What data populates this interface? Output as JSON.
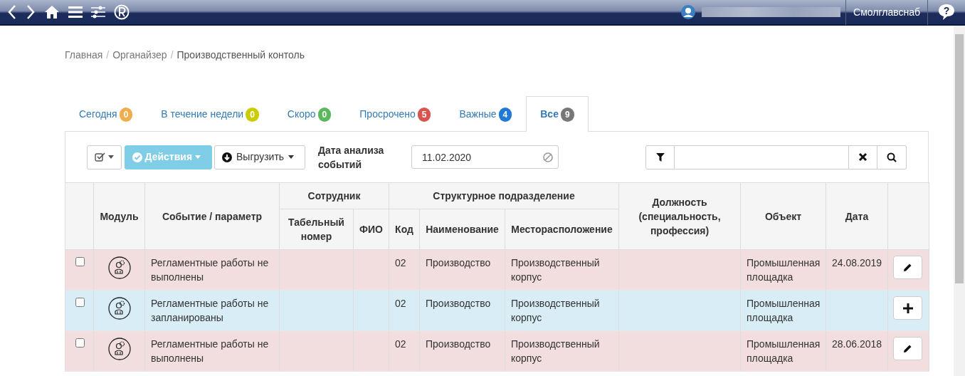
{
  "topbar": {
    "org": "Смолглавснаб",
    "help": "?"
  },
  "breadcrumb": [
    {
      "label": "Главная",
      "current": false
    },
    {
      "separator": "/",
      "label": "Органайзер",
      "current": false
    },
    {
      "separator": "/",
      "label": "Производственный контоль",
      "current": true
    }
  ],
  "tabs": [
    {
      "label": "Сегодня",
      "count": "0",
      "color": "#f0ad4e",
      "selected": false
    },
    {
      "label": "В течение недели",
      "count": "0",
      "color": "#cccc00",
      "selected": false
    },
    {
      "label": "Скоро",
      "count": "0",
      "color": "#5cb85c",
      "selected": false
    },
    {
      "label": "Просрочено",
      "count": "5",
      "color": "#d9534f",
      "selected": false
    },
    {
      "label": "Важные",
      "count": "4",
      "color": "#1e7ad6",
      "selected": false
    },
    {
      "label": "Все",
      "count": "9",
      "color": "#777777",
      "selected": true
    }
  ],
  "toolbar": {
    "actions": "Действия",
    "export": "Выгрузить",
    "date_label": "Дата анализа событий",
    "date_value": "11.02.2020"
  },
  "table": {
    "headers": {
      "module": "Модуль",
      "event": "Событие / параметр",
      "employee": "Сотрудник",
      "tab_number": "Табельный номер",
      "fio": "ФИО",
      "division": "Структурное подразделение",
      "code": "Код",
      "name": "Наименование",
      "location": "Месторасположение",
      "position": "Должность (специальность, профессия)",
      "object": "Объект",
      "date": "Дата"
    },
    "rows": [
      {
        "kind": "overdue",
        "checked": false,
        "event": "Регламентные работы не выполнены",
        "code": "02",
        "name": "Производство",
        "location": "Производственный корпус",
        "object": "Промышленная площадка",
        "date": "24.08.2019",
        "action": {
          "kind": "edit"
        }
      },
      {
        "kind": "unplanned",
        "checked": false,
        "event": "Регламентные работы не запланированы",
        "code": "02",
        "name": "Производство",
        "location": "Производственный корпус",
        "object": "Промышленная площадка",
        "action": {
          "kind": "add"
        }
      },
      {
        "kind": "overdue",
        "checked": false,
        "event": "Регламентные работы не выполнены",
        "code": "02",
        "name": "Производство",
        "location": "Производственный корпус",
        "object": "Промышленная площадка",
        "date": "28.06.2018",
        "action": {
          "kind": "edit"
        }
      }
    ]
  }
}
